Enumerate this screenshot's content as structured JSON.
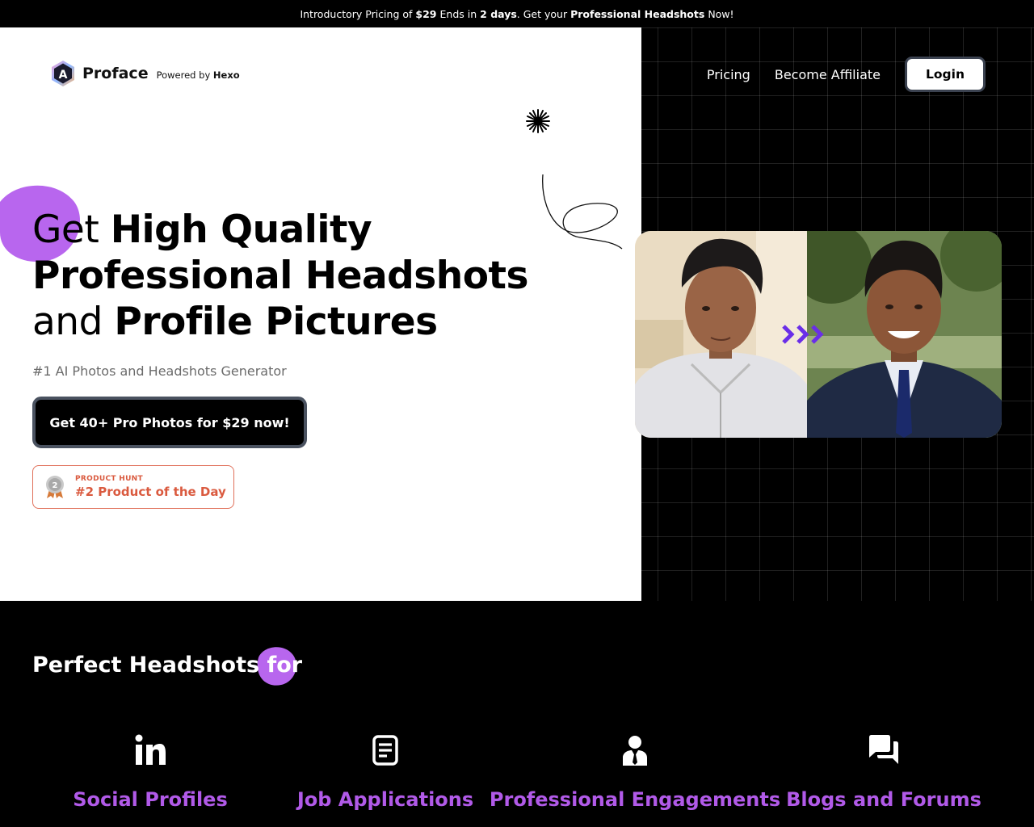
{
  "announcement": {
    "part1": "Introductory Pricing of",
    "price": "$29",
    "part2": "Ends in",
    "days": "2 days",
    "part3": ". Get your",
    "product": "Professional Headshots",
    "part4": "Now!"
  },
  "brand": {
    "name": "Proface",
    "powered_prefix": "Powered by",
    "powered_by": "Hexo",
    "logo_letter": "A"
  },
  "nav": {
    "pricing": "Pricing",
    "affiliate": "Become Affiliate",
    "login": "Login"
  },
  "hero": {
    "headline": {
      "l1a": "Get ",
      "l1b": "High Quality",
      "l2": "Professional Headshots",
      "l3a": "and ",
      "l3b": "Profile Pictures"
    },
    "subheadline": "#1 AI Photos and Headshots Generator",
    "cta": "Get 40+ Pro Photos for $29 now!",
    "badge": {
      "rank": "2",
      "small": "PRODUCT HUNT",
      "big": "#2 Product of the Day"
    }
  },
  "uses_section": {
    "title": "Perfect Headshots for",
    "items": [
      {
        "label": "Social Profiles",
        "icon": "linkedin-icon"
      },
      {
        "label": "Job Applications",
        "icon": "document-icon"
      },
      {
        "label": "Professional Engagements",
        "icon": "businessperson-icon"
      },
      {
        "label": "Blogs and Forums",
        "icon": "chat-bubbles-icon"
      }
    ]
  },
  "colors": {
    "accent_purple": "#b15ae8",
    "blob_purple": "#b866ee",
    "arrow_purple": "#6a2ee8",
    "badge_orange": "#da5a3f"
  }
}
